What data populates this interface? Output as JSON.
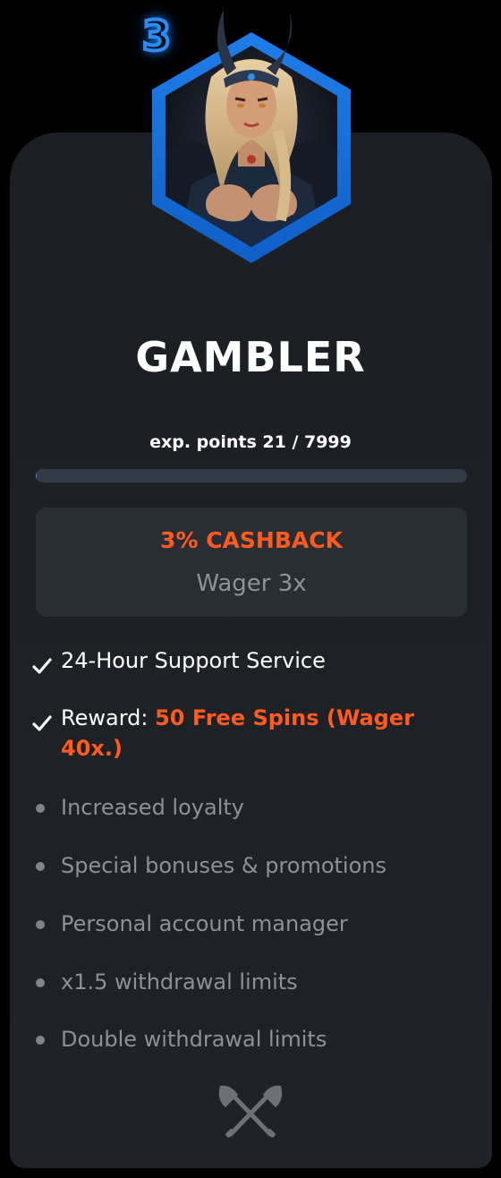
{
  "level": {
    "number": "3",
    "title": "GAMBLER",
    "exp_text": "exp. points 21 / 7999",
    "progress_fraction": 0.0026
  },
  "cashback": {
    "title": "3% CASHBACK",
    "wager": "Wager 3x"
  },
  "features": [
    {
      "prefix": "24-Hour Support Service",
      "highlight": "",
      "included": true,
      "icon": "check-icon"
    },
    {
      "prefix": "Reward: ",
      "highlight": "50 Free Spins (Wager 40x.)",
      "included": true,
      "icon": "check-icon"
    },
    {
      "prefix": "Increased loyalty",
      "highlight": "",
      "included": false,
      "icon": "bullet-icon"
    },
    {
      "prefix": "Special bonuses & promotions",
      "highlight": "",
      "included": false,
      "icon": "bullet-icon"
    },
    {
      "prefix": "Personal account manager",
      "highlight": "",
      "included": false,
      "icon": "bullet-icon"
    },
    {
      "prefix": "x1.5 withdrawal limits",
      "highlight": "",
      "included": false,
      "icon": "bullet-icon"
    },
    {
      "prefix": "Double withdrawal limits",
      "highlight": "",
      "included": false,
      "icon": "bullet-icon"
    }
  ],
  "footer_icon": "crossed-axes-icon",
  "colors": {
    "accent_orange": "#ff5a1f",
    "badge_blue": "#2b8df2",
    "card_bg": "#1e2227",
    "muted_text": "#8d9197"
  }
}
